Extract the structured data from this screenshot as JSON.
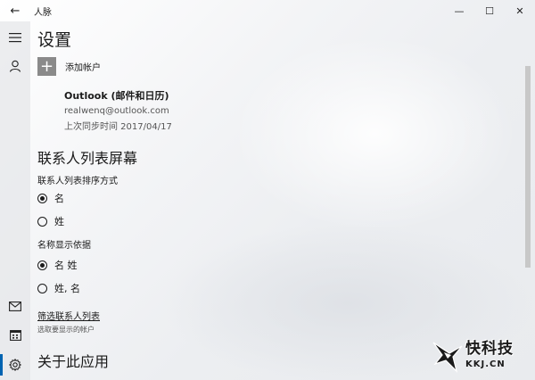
{
  "window": {
    "title": "人脉",
    "back_icon": "←",
    "minimize_icon": "—",
    "maximize_icon": "☐",
    "close_icon": "✕"
  },
  "nav": {
    "items": [
      {
        "name": "hamburger-menu-icon"
      },
      {
        "name": "person-icon"
      },
      {
        "name": "mail-icon"
      },
      {
        "name": "calendar-icon"
      },
      {
        "name": "settings-icon",
        "active": true
      }
    ],
    "accent": "#0063b1"
  },
  "page": {
    "title": "设置"
  },
  "accounts": {
    "add_label": "添加帐户",
    "add_icon": "+",
    "list": [
      {
        "name": "Outlook (邮件和日历)",
        "email": "realwenq@outlook.com",
        "last_sync": "上次同步时间 2017/04/17"
      }
    ]
  },
  "contact_list": {
    "section_title": "联系人列表屏幕",
    "sort": {
      "label": "联系人列表排序方式",
      "options": [
        {
          "label": "名",
          "selected": true
        },
        {
          "label": "姓",
          "selected": false
        }
      ]
    },
    "display": {
      "label": "名称显示依据",
      "options": [
        {
          "label": "名 姓",
          "selected": true
        },
        {
          "label": "姓, 名",
          "selected": false
        }
      ]
    },
    "filter_link": "筛选联系人列表",
    "filter_desc": "选取要显示的帐户"
  },
  "about": {
    "section_title": "关于此应用"
  },
  "watermark": {
    "cn": "快科技",
    "en": "KKJ.CN"
  }
}
